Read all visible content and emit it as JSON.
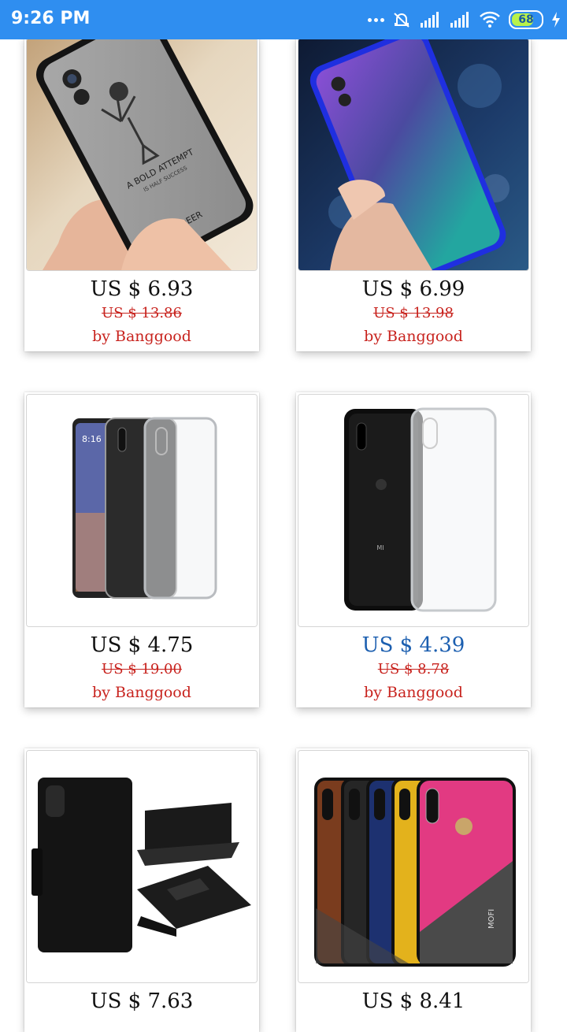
{
  "status_bar": {
    "time": "9:26 PM",
    "battery": "68"
  },
  "products": [
    {
      "price": "US $ 6.93",
      "old_price": "US $ 13.86",
      "seller": "by Banggood",
      "image": "deer-fabric-case",
      "engraving_1": "A BOLD ATTEMPT",
      "engraving_2": "IS HALF SUCCESS",
      "engraving_3": "DEER"
    },
    {
      "price": "US $ 6.99",
      "old_price": "US $ 13.98",
      "seller": "by Banggood",
      "image": "purple-gradient-case"
    },
    {
      "price": "US $ 4.75",
      "old_price": "US $ 19.00",
      "seller": "by Banggood",
      "image": "clear-tpu-case",
      "screen_time": "8:16"
    },
    {
      "price": "US $ 4.39",
      "old_price": "US $ 8.78",
      "seller": "by Banggood",
      "image": "black-phone-clear-case",
      "price_color": "#1c5fb0",
      "phone_logo": "MI"
    },
    {
      "price": "US $ 7.63",
      "old_price": "",
      "seller": "",
      "image": "black-leather-wallet-case"
    },
    {
      "price": "US $ 8.41",
      "old_price": "",
      "seller": "",
      "image": "multicolor-fabric-cases",
      "brand": "MOFI"
    }
  ],
  "colors": {
    "status_bar": "#2f8ef0",
    "discount_red": "#c8231e",
    "price_blue": "#1c5fb0"
  }
}
